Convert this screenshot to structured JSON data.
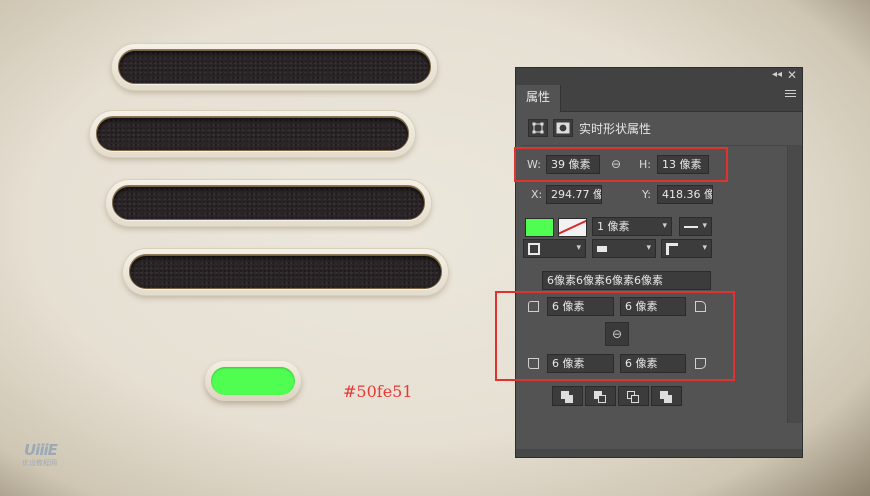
{
  "canvas": {
    "hex_label": "#50fe51",
    "logo": "UiiiE",
    "logo_sub": "优设教程网",
    "fill_color": "#50fe51"
  },
  "panel": {
    "tab": "属性",
    "header_title": "实时形状属性",
    "size": {
      "w_label": "W:",
      "w_value": "39 像素",
      "h_label": "H:",
      "h_value": "13 像素"
    },
    "position": {
      "x_label": "X:",
      "x_value": "294.77 像",
      "y_label": "Y:",
      "y_value": "418.36 像"
    },
    "stroke": {
      "fill_color": "#50fe51",
      "width_value": "1 像素"
    },
    "corners": {
      "combined": "6像素6像素6像素6像素",
      "top_left": "6 像素",
      "top_right": "6 像素",
      "bottom_left": "6 像素",
      "bottom_right": "6 像素"
    },
    "highlight_color": "#e0322e"
  }
}
